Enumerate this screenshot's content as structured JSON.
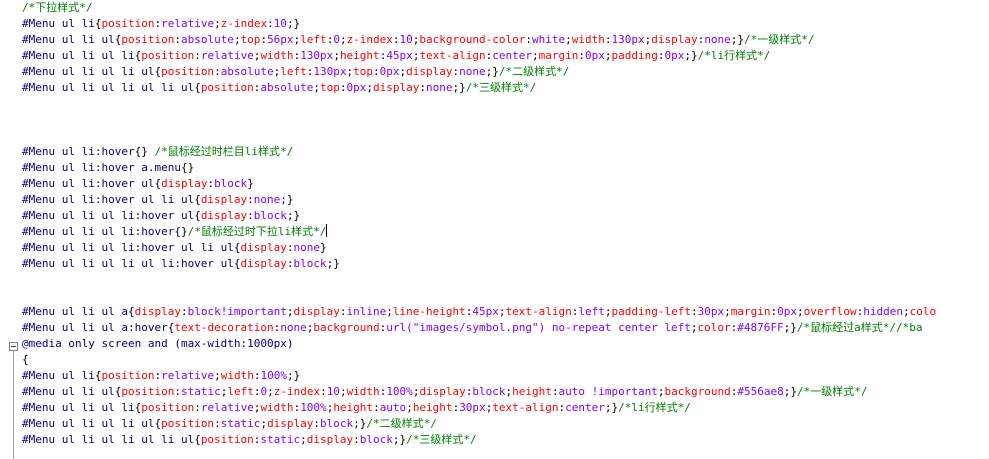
{
  "editor": {
    "lines": [
      [
        {
          "t": "cmt",
          "s": "/*下拉样式*/"
        }
      ],
      [
        {
          "t": "sel",
          "s": "#Menu ul li"
        },
        {
          "t": "pun",
          "s": "{"
        },
        {
          "t": "prop",
          "s": "position"
        },
        {
          "t": "pun",
          "s": ":"
        },
        {
          "t": "val",
          "s": "relative"
        },
        {
          "t": "pun",
          "s": ";"
        },
        {
          "t": "prop",
          "s": "z-index"
        },
        {
          "t": "pun",
          "s": ":"
        },
        {
          "t": "val",
          "s": "10"
        },
        {
          "t": "pun",
          "s": ";}"
        }
      ],
      [
        {
          "t": "sel",
          "s": "#Menu ul li ul"
        },
        {
          "t": "pun",
          "s": "{"
        },
        {
          "t": "prop",
          "s": "position"
        },
        {
          "t": "pun",
          "s": ":"
        },
        {
          "t": "val",
          "s": "absolute"
        },
        {
          "t": "pun",
          "s": ";"
        },
        {
          "t": "prop",
          "s": "top"
        },
        {
          "t": "pun",
          "s": ":"
        },
        {
          "t": "val",
          "s": "56px"
        },
        {
          "t": "pun",
          "s": ";"
        },
        {
          "t": "prop",
          "s": "left"
        },
        {
          "t": "pun",
          "s": ":"
        },
        {
          "t": "val",
          "s": "0"
        },
        {
          "t": "pun",
          "s": ";"
        },
        {
          "t": "prop",
          "s": "z-index"
        },
        {
          "t": "pun",
          "s": ":"
        },
        {
          "t": "val",
          "s": "10"
        },
        {
          "t": "pun",
          "s": ";"
        },
        {
          "t": "prop",
          "s": "background-color"
        },
        {
          "t": "pun",
          "s": ":"
        },
        {
          "t": "val",
          "s": "white"
        },
        {
          "t": "pun",
          "s": ";"
        },
        {
          "t": "prop",
          "s": "width"
        },
        {
          "t": "pun",
          "s": ":"
        },
        {
          "t": "val",
          "s": "130px"
        },
        {
          "t": "pun",
          "s": ";"
        },
        {
          "t": "prop",
          "s": "display"
        },
        {
          "t": "pun",
          "s": ":"
        },
        {
          "t": "val",
          "s": "none"
        },
        {
          "t": "pun",
          "s": ";}"
        },
        {
          "t": "cmt",
          "s": "/*一级样式*/"
        }
      ],
      [
        {
          "t": "sel",
          "s": "#Menu ul li ul li"
        },
        {
          "t": "pun",
          "s": "{"
        },
        {
          "t": "prop",
          "s": "position"
        },
        {
          "t": "pun",
          "s": ":"
        },
        {
          "t": "val",
          "s": "relative"
        },
        {
          "t": "pun",
          "s": ";"
        },
        {
          "t": "prop",
          "s": "width"
        },
        {
          "t": "pun",
          "s": ":"
        },
        {
          "t": "val",
          "s": "130px"
        },
        {
          "t": "pun",
          "s": ";"
        },
        {
          "t": "prop",
          "s": "height"
        },
        {
          "t": "pun",
          "s": ":"
        },
        {
          "t": "val",
          "s": "45px"
        },
        {
          "t": "pun",
          "s": ";"
        },
        {
          "t": "prop",
          "s": "text-align"
        },
        {
          "t": "pun",
          "s": ":"
        },
        {
          "t": "val",
          "s": "center"
        },
        {
          "t": "pun",
          "s": ";"
        },
        {
          "t": "prop",
          "s": "margin"
        },
        {
          "t": "pun",
          "s": ":"
        },
        {
          "t": "val",
          "s": "0px"
        },
        {
          "t": "pun",
          "s": ";"
        },
        {
          "t": "prop",
          "s": "padding"
        },
        {
          "t": "pun",
          "s": ":"
        },
        {
          "t": "val",
          "s": "0px"
        },
        {
          "t": "pun",
          "s": ";}"
        },
        {
          "t": "cmt",
          "s": "/*li行样式*/"
        }
      ],
      [
        {
          "t": "sel",
          "s": "#Menu ul li ul li ul"
        },
        {
          "t": "pun",
          "s": "{"
        },
        {
          "t": "prop",
          "s": "position"
        },
        {
          "t": "pun",
          "s": ":"
        },
        {
          "t": "val",
          "s": "absolute"
        },
        {
          "t": "pun",
          "s": ";"
        },
        {
          "t": "prop",
          "s": "left"
        },
        {
          "t": "pun",
          "s": ":"
        },
        {
          "t": "val",
          "s": "130px"
        },
        {
          "t": "pun",
          "s": ";"
        },
        {
          "t": "prop",
          "s": "top"
        },
        {
          "t": "pun",
          "s": ":"
        },
        {
          "t": "val",
          "s": "0px"
        },
        {
          "t": "pun",
          "s": ";"
        },
        {
          "t": "prop",
          "s": "display"
        },
        {
          "t": "pun",
          "s": ":"
        },
        {
          "t": "val",
          "s": "none"
        },
        {
          "t": "pun",
          "s": ";}"
        },
        {
          "t": "cmt",
          "s": "/*二级样式*/"
        }
      ],
      [
        {
          "t": "sel",
          "s": "#Menu ul li ul li ul li ul"
        },
        {
          "t": "pun",
          "s": "{"
        },
        {
          "t": "prop",
          "s": "position"
        },
        {
          "t": "pun",
          "s": ":"
        },
        {
          "t": "val",
          "s": "absolute"
        },
        {
          "t": "pun",
          "s": ";"
        },
        {
          "t": "prop",
          "s": "top"
        },
        {
          "t": "pun",
          "s": ":"
        },
        {
          "t": "val",
          "s": "0px"
        },
        {
          "t": "pun",
          "s": ";"
        },
        {
          "t": "prop",
          "s": "display"
        },
        {
          "t": "pun",
          "s": ":"
        },
        {
          "t": "val",
          "s": "none"
        },
        {
          "t": "pun",
          "s": ";}"
        },
        {
          "t": "cmt",
          "s": "/*三级样式*/"
        }
      ],
      [],
      [],
      [],
      [
        {
          "t": "sel",
          "s": "#Menu ul li:hover"
        },
        {
          "t": "pun",
          "s": "{} "
        },
        {
          "t": "cmt",
          "s": "/*鼠标经过时栏目li样式*/"
        }
      ],
      [
        {
          "t": "sel",
          "s": "#Menu ul li:hover a.menu"
        },
        {
          "t": "pun",
          "s": "{}"
        }
      ],
      [
        {
          "t": "sel",
          "s": "#Menu ul li:hover ul"
        },
        {
          "t": "pun",
          "s": "{"
        },
        {
          "t": "prop",
          "s": "display"
        },
        {
          "t": "pun",
          "s": ":"
        },
        {
          "t": "val",
          "s": "block"
        },
        {
          "t": "pun",
          "s": "}"
        }
      ],
      [
        {
          "t": "sel",
          "s": "#Menu ul li:hover ul li ul"
        },
        {
          "t": "pun",
          "s": "{"
        },
        {
          "t": "prop",
          "s": "display"
        },
        {
          "t": "pun",
          "s": ":"
        },
        {
          "t": "val",
          "s": "none"
        },
        {
          "t": "pun",
          "s": ";}"
        }
      ],
      [
        {
          "t": "sel",
          "s": "#Menu ul li ul li:hover ul"
        },
        {
          "t": "pun",
          "s": "{"
        },
        {
          "t": "prop",
          "s": "display"
        },
        {
          "t": "pun",
          "s": ":"
        },
        {
          "t": "val",
          "s": "block"
        },
        {
          "t": "pun",
          "s": ";}"
        }
      ],
      [
        {
          "t": "sel",
          "s": "#Menu ul li ul li:hover"
        },
        {
          "t": "pun",
          "s": "{}"
        },
        {
          "t": "cmt",
          "s": "/*鼠标经过时下拉li样式*/"
        },
        {
          "t": "caret",
          "s": ""
        }
      ],
      [
        {
          "t": "sel",
          "s": "#Menu ul li ul li:hover ul li ul"
        },
        {
          "t": "pun",
          "s": "{"
        },
        {
          "t": "prop",
          "s": "display"
        },
        {
          "t": "pun",
          "s": ":"
        },
        {
          "t": "val",
          "s": "none"
        },
        {
          "t": "pun",
          "s": "}"
        }
      ],
      [
        {
          "t": "sel",
          "s": "#Menu ul li ul li ul li:hover ul"
        },
        {
          "t": "pun",
          "s": "{"
        },
        {
          "t": "prop",
          "s": "display"
        },
        {
          "t": "pun",
          "s": ":"
        },
        {
          "t": "val",
          "s": "block"
        },
        {
          "t": "pun",
          "s": ";}"
        }
      ],
      [],
      [],
      [
        {
          "t": "sel",
          "s": "#Menu ul li ul a"
        },
        {
          "t": "pun",
          "s": "{"
        },
        {
          "t": "prop",
          "s": "display"
        },
        {
          "t": "pun",
          "s": ":"
        },
        {
          "t": "val",
          "s": "block!important"
        },
        {
          "t": "pun",
          "s": ";"
        },
        {
          "t": "prop",
          "s": "display"
        },
        {
          "t": "pun",
          "s": ":"
        },
        {
          "t": "val",
          "s": "inline"
        },
        {
          "t": "pun",
          "s": ";"
        },
        {
          "t": "prop",
          "s": "line-height"
        },
        {
          "t": "pun",
          "s": ":"
        },
        {
          "t": "val",
          "s": "45px"
        },
        {
          "t": "pun",
          "s": ";"
        },
        {
          "t": "prop",
          "s": "text-align"
        },
        {
          "t": "pun",
          "s": ":"
        },
        {
          "t": "val",
          "s": "left"
        },
        {
          "t": "pun",
          "s": ";"
        },
        {
          "t": "prop",
          "s": "padding-left"
        },
        {
          "t": "pun",
          "s": ":"
        },
        {
          "t": "val",
          "s": "30px"
        },
        {
          "t": "pun",
          "s": ";"
        },
        {
          "t": "prop",
          "s": "margin"
        },
        {
          "t": "pun",
          "s": ":"
        },
        {
          "t": "val",
          "s": "0px"
        },
        {
          "t": "pun",
          "s": ";"
        },
        {
          "t": "prop",
          "s": "overflow"
        },
        {
          "t": "pun",
          "s": ":"
        },
        {
          "t": "val",
          "s": "hidden"
        },
        {
          "t": "pun",
          "s": ";"
        },
        {
          "t": "prop",
          "s": "colo"
        }
      ],
      [
        {
          "t": "sel",
          "s": "#Menu ul li ul a:hover"
        },
        {
          "t": "pun",
          "s": "{"
        },
        {
          "t": "prop",
          "s": "text-decoration"
        },
        {
          "t": "pun",
          "s": ":"
        },
        {
          "t": "val",
          "s": "none"
        },
        {
          "t": "pun",
          "s": ";"
        },
        {
          "t": "prop",
          "s": "background"
        },
        {
          "t": "pun",
          "s": ":"
        },
        {
          "t": "val",
          "s": "url(\"images/symbol.png\") no-repeat center left"
        },
        {
          "t": "pun",
          "s": ";"
        },
        {
          "t": "prop",
          "s": "color"
        },
        {
          "t": "pun",
          "s": ":"
        },
        {
          "t": "val",
          "s": "#4876FF"
        },
        {
          "t": "pun",
          "s": ";}"
        },
        {
          "t": "cmt",
          "s": "/*鼠标经过a样式*//*ba"
        }
      ],
      [
        {
          "t": "sel",
          "s": "@media only screen and (max-width:1000px)"
        }
      ],
      [
        {
          "t": "pun",
          "s": "{"
        }
      ],
      [
        {
          "t": "sel",
          "s": "#Menu ul li"
        },
        {
          "t": "pun",
          "s": "{"
        },
        {
          "t": "prop",
          "s": "position"
        },
        {
          "t": "pun",
          "s": ":"
        },
        {
          "t": "val",
          "s": "relative"
        },
        {
          "t": "pun",
          "s": ";"
        },
        {
          "t": "prop",
          "s": "width"
        },
        {
          "t": "pun",
          "s": ":"
        },
        {
          "t": "val",
          "s": "100%"
        },
        {
          "t": "pun",
          "s": ";}"
        }
      ],
      [
        {
          "t": "sel",
          "s": "#Menu ul li ul"
        },
        {
          "t": "pun",
          "s": "{"
        },
        {
          "t": "prop",
          "s": "position"
        },
        {
          "t": "pun",
          "s": ":"
        },
        {
          "t": "val",
          "s": "static"
        },
        {
          "t": "pun",
          "s": ";"
        },
        {
          "t": "prop",
          "s": "left"
        },
        {
          "t": "pun",
          "s": ":"
        },
        {
          "t": "val",
          "s": "0"
        },
        {
          "t": "pun",
          "s": ";"
        },
        {
          "t": "prop",
          "s": "z-index"
        },
        {
          "t": "pun",
          "s": ":"
        },
        {
          "t": "val",
          "s": "10"
        },
        {
          "t": "pun",
          "s": ";"
        },
        {
          "t": "prop",
          "s": "width"
        },
        {
          "t": "pun",
          "s": ":"
        },
        {
          "t": "val",
          "s": "100%"
        },
        {
          "t": "pun",
          "s": ";"
        },
        {
          "t": "prop",
          "s": "display"
        },
        {
          "t": "pun",
          "s": ":"
        },
        {
          "t": "val",
          "s": "block"
        },
        {
          "t": "pun",
          "s": ";"
        },
        {
          "t": "prop",
          "s": "height"
        },
        {
          "t": "pun",
          "s": ":"
        },
        {
          "t": "val",
          "s": "auto !important"
        },
        {
          "t": "pun",
          "s": ";"
        },
        {
          "t": "prop",
          "s": "background"
        },
        {
          "t": "pun",
          "s": ":"
        },
        {
          "t": "val",
          "s": "#556ae8"
        },
        {
          "t": "pun",
          "s": ";}"
        },
        {
          "t": "cmt",
          "s": "/*一级样式*/"
        }
      ],
      [
        {
          "t": "sel",
          "s": "#Menu ul li ul li"
        },
        {
          "t": "pun",
          "s": "{"
        },
        {
          "t": "prop",
          "s": "position"
        },
        {
          "t": "pun",
          "s": ":"
        },
        {
          "t": "val",
          "s": "relative"
        },
        {
          "t": "pun",
          "s": ";"
        },
        {
          "t": "prop",
          "s": "width"
        },
        {
          "t": "pun",
          "s": ":"
        },
        {
          "t": "val",
          "s": "100%"
        },
        {
          "t": "pun",
          "s": ";"
        },
        {
          "t": "prop",
          "s": "height"
        },
        {
          "t": "pun",
          "s": ":"
        },
        {
          "t": "val",
          "s": "auto"
        },
        {
          "t": "pun",
          "s": ";"
        },
        {
          "t": "prop",
          "s": "height"
        },
        {
          "t": "pun",
          "s": ":"
        },
        {
          "t": "val",
          "s": "30px"
        },
        {
          "t": "pun",
          "s": ";"
        },
        {
          "t": "prop",
          "s": "text-align"
        },
        {
          "t": "pun",
          "s": ":"
        },
        {
          "t": "val",
          "s": "center"
        },
        {
          "t": "pun",
          "s": ";}"
        },
        {
          "t": "cmt",
          "s": "/*li行样式*/"
        }
      ],
      [
        {
          "t": "sel",
          "s": "#Menu ul li ul li ul"
        },
        {
          "t": "pun",
          "s": "{"
        },
        {
          "t": "prop",
          "s": "position"
        },
        {
          "t": "pun",
          "s": ":"
        },
        {
          "t": "val",
          "s": "static"
        },
        {
          "t": "pun",
          "s": ";"
        },
        {
          "t": "prop",
          "s": "display"
        },
        {
          "t": "pun",
          "s": ":"
        },
        {
          "t": "val",
          "s": "block"
        },
        {
          "t": "pun",
          "s": ";}"
        },
        {
          "t": "cmt",
          "s": "/*二级样式*/"
        }
      ],
      [
        {
          "t": "sel",
          "s": "#Menu ul li ul li ul li ul"
        },
        {
          "t": "pun",
          "s": "{"
        },
        {
          "t": "prop",
          "s": "position"
        },
        {
          "t": "pun",
          "s": ":"
        },
        {
          "t": "val",
          "s": "static"
        },
        {
          "t": "pun",
          "s": ";"
        },
        {
          "t": "prop",
          "s": "display"
        },
        {
          "t": "pun",
          "s": ":"
        },
        {
          "t": "val",
          "s": "block"
        },
        {
          "t": "pun",
          "s": ";}"
        },
        {
          "t": "cmt",
          "s": "/*三级样式*/"
        }
      ]
    ]
  }
}
